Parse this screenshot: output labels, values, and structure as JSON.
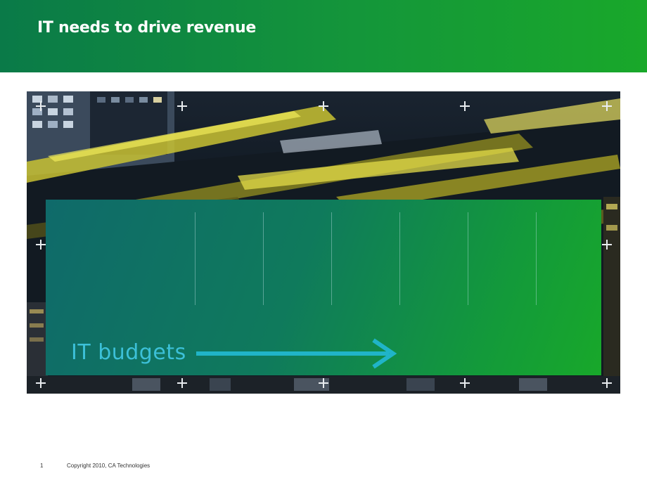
{
  "slide": {
    "title": "IT needs to drive revenue",
    "panel_label": "IT budgets"
  },
  "footer": {
    "page_number": "1",
    "copyright": "Copyright 2010, CA Technologies"
  },
  "colors": {
    "header_green": "#14963a",
    "label_cyan": "#3cc0d8"
  },
  "icons": {
    "crosshair": "plus-marker-icon",
    "arrow": "right-arrow-icon"
  }
}
